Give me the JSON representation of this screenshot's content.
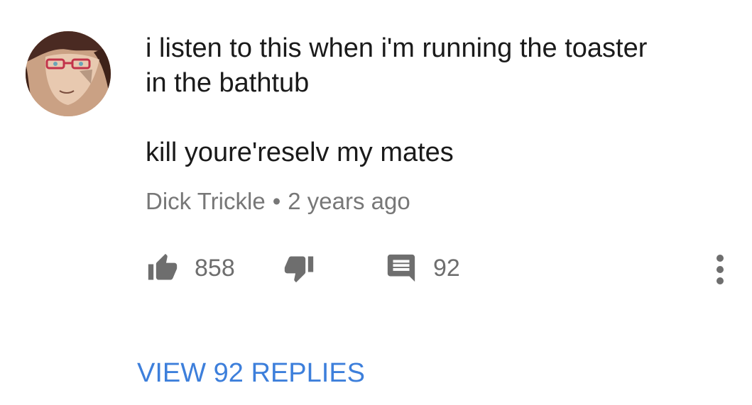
{
  "comment": {
    "lines": [
      "i listen to this when i'm running the toaster",
      "in the bathtub",
      "kill youre'reselv my mates"
    ],
    "author": "Dick Trickle",
    "separator": "•",
    "timestamp": "2 years ago"
  },
  "actions": {
    "likes": "858",
    "replies_count": "92",
    "like_icon": "thumb-up-icon",
    "dislike_icon": "thumb-down-icon",
    "reply_icon": "comment-icon",
    "more_icon": "more-vertical-icon"
  },
  "view_replies_label": "VIEW 92 REPLIES",
  "colors": {
    "text": "#1a1a1a",
    "meta": "#777777",
    "icon": "#6e6e6e",
    "link": "#3d7fdb"
  }
}
